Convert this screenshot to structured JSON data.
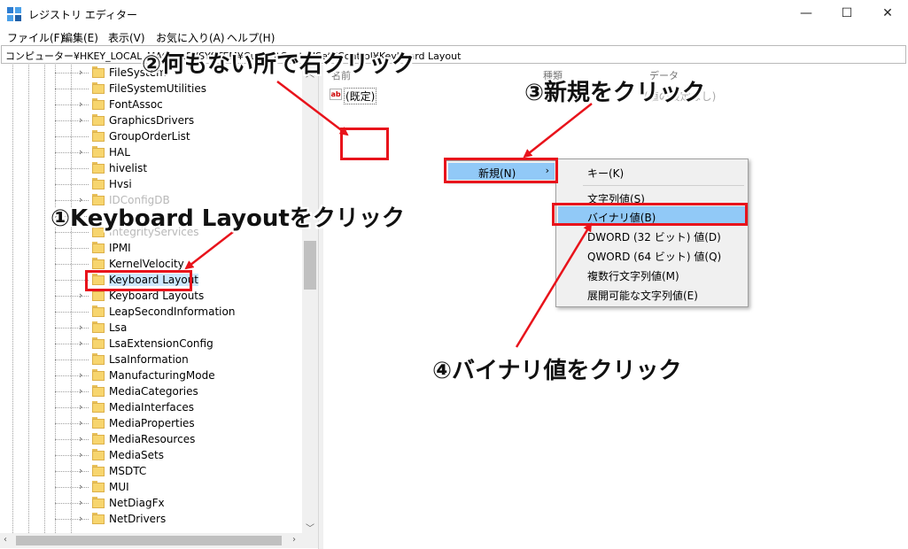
{
  "window": {
    "title": "レジストリ エディター",
    "minimize": "—",
    "maximize": "☐",
    "close": "✕"
  },
  "menu": [
    "ファイル(F)",
    "編集(E)",
    "表示(V)",
    "お気に入り(A)",
    "ヘルプ(H)"
  ],
  "address": "コンピューター¥HKEY_LOCAL_MACHINE¥SYSTEM¥CurrentControlSet¥Control¥Keyboard Layout",
  "tree": {
    "items": [
      {
        "label": "FileSystem",
        "expandable": true
      },
      {
        "label": "FileSystemUtilities",
        "expandable": false
      },
      {
        "label": "FontAssoc",
        "expandable": true
      },
      {
        "label": "GraphicsDrivers",
        "expandable": true
      },
      {
        "label": "GroupOrderList",
        "expandable": false
      },
      {
        "label": "HAL",
        "expandable": true
      },
      {
        "label": "hivelist",
        "expandable": false
      },
      {
        "label": "Hvsi",
        "expandable": false
      },
      {
        "label": "IDConfigDB",
        "expandable": true
      },
      {
        "label": "",
        "expandable": false
      },
      {
        "label": "IntegrityServices",
        "expandable": false
      },
      {
        "label": "IPMI",
        "expandable": false
      },
      {
        "label": "KernelVelocity",
        "expandable": false
      },
      {
        "label": "Keyboard Layout",
        "expandable": false,
        "selected": true
      },
      {
        "label": "Keyboard Layouts",
        "expandable": true
      },
      {
        "label": "LeapSecondInformation",
        "expandable": false
      },
      {
        "label": "Lsa",
        "expandable": true
      },
      {
        "label": "LsaExtensionConfig",
        "expandable": true
      },
      {
        "label": "LsaInformation",
        "expandable": false
      },
      {
        "label": "ManufacturingMode",
        "expandable": true
      },
      {
        "label": "MediaCategories",
        "expandable": true
      },
      {
        "label": "MediaInterfaces",
        "expandable": true
      },
      {
        "label": "MediaProperties",
        "expandable": true
      },
      {
        "label": "MediaResources",
        "expandable": true
      },
      {
        "label": "MediaSets",
        "expandable": true
      },
      {
        "label": "MSDTC",
        "expandable": true
      },
      {
        "label": "MUI",
        "expandable": true
      },
      {
        "label": "NetDiagFx",
        "expandable": true
      },
      {
        "label": "NetDrivers",
        "expandable": true
      }
    ]
  },
  "list": {
    "columns": {
      "name": "名前",
      "type": "種類",
      "data": "データ"
    },
    "rows": [
      {
        "icon": "ab",
        "name": "(既定)",
        "data": "(値の設定なし)"
      }
    ]
  },
  "context_menu": {
    "new_label": "新規(N)",
    "new_arrow": "›",
    "submenu": [
      "キー(K)",
      "文字列値(S)",
      "バイナリ値(B)",
      "DWORD (32 ビット) 値(D)",
      "QWORD (64 ビット) 値(Q)",
      "複数行文字列値(M)",
      "展開可能な文字列値(E)"
    ]
  },
  "annotations": {
    "step1": "①Keyboard Layoutをクリック",
    "step2": "②何もない所で右クリック",
    "step3": "③新規をクリック",
    "step4": "④バイナリ値をクリック",
    "color": "#e8131b"
  }
}
